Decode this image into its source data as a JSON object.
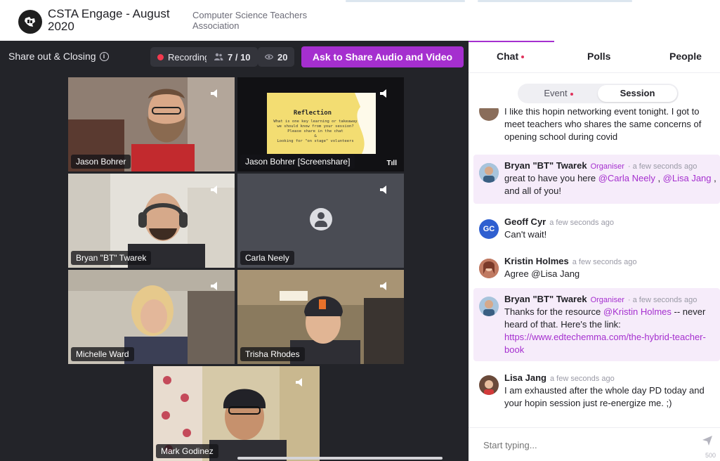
{
  "header": {
    "event_title": "CSTA Engage - August 2020",
    "organization": "Computer Science Teachers Association"
  },
  "stage": {
    "session_title": "Share out & Closing",
    "recording_label": "Recording",
    "attendees_count": "7 / 10",
    "viewers_count": "20",
    "share_button_label": "Ask to Share Audio and Video",
    "tiles": [
      {
        "name": "Jason Bohrer"
      },
      {
        "name": "Jason Bohrer [Screenshare]"
      },
      {
        "name": "Bryan \"BT\" Twarek"
      },
      {
        "name": "Carla Neely"
      },
      {
        "name": "Michelle Ward"
      },
      {
        "name": "Trisha Rhodes"
      },
      {
        "name": "Mark Godinez"
      }
    ],
    "slide": {
      "title": "Reflection",
      "line1": "What is one key learning or takeaway",
      "line2": "we should know from your session?",
      "line3": "Please share in the chat",
      "line4": "&",
      "line5": "Looking for \"on stage\" volunteers"
    },
    "signal_label": "Tıll"
  },
  "panel": {
    "tabs": [
      "Chat",
      "Polls",
      "People"
    ],
    "toggle": {
      "event": "Event",
      "session": "Session"
    },
    "messages": [
      {
        "text": "I like this hopin networking event tonight. I got to meet teachers who shares the same concerns of opening school during covid"
      },
      {
        "author": "Bryan \"BT\" Twarek",
        "role": "Organiser",
        "time": "· a few seconds ago",
        "text_a": "great to have you here ",
        "mention_1": "@Carla Neely",
        "text_b": " , ",
        "mention_2": "@Lisa Jang",
        "text_c": " , and all of you!"
      },
      {
        "author": "Geoff Cyr",
        "initials": "GC",
        "time": "a few seconds ago",
        "text": "Can't wait!"
      },
      {
        "author": "Kristin Holmes",
        "time": "a few seconds ago",
        "text": "Agree @Lisa Jang"
      },
      {
        "author": "Bryan \"BT\" Twarek",
        "role": "Organiser",
        "time": "· a few seconds ago",
        "text_a": "Thanks for the resource ",
        "mention_1": "@Kristin Holmes",
        "text_b": " -- never heard of that. Here's the link: ",
        "link": "https://www.edtechemma.com/the-hybrid-teacher-book"
      },
      {
        "author": "Lisa Jang",
        "time": "a few seconds ago",
        "text": "I am exhausted after the whole day PD today and your hopin session just re-energize me. ;)"
      }
    ],
    "composer": {
      "placeholder": "Start typing...",
      "char_count": "500"
    }
  },
  "colors": {
    "accent": "#a52fcf",
    "stage_bg": "#232429",
    "recording": "#f2394e",
    "highlight": "#f6ecfa"
  }
}
